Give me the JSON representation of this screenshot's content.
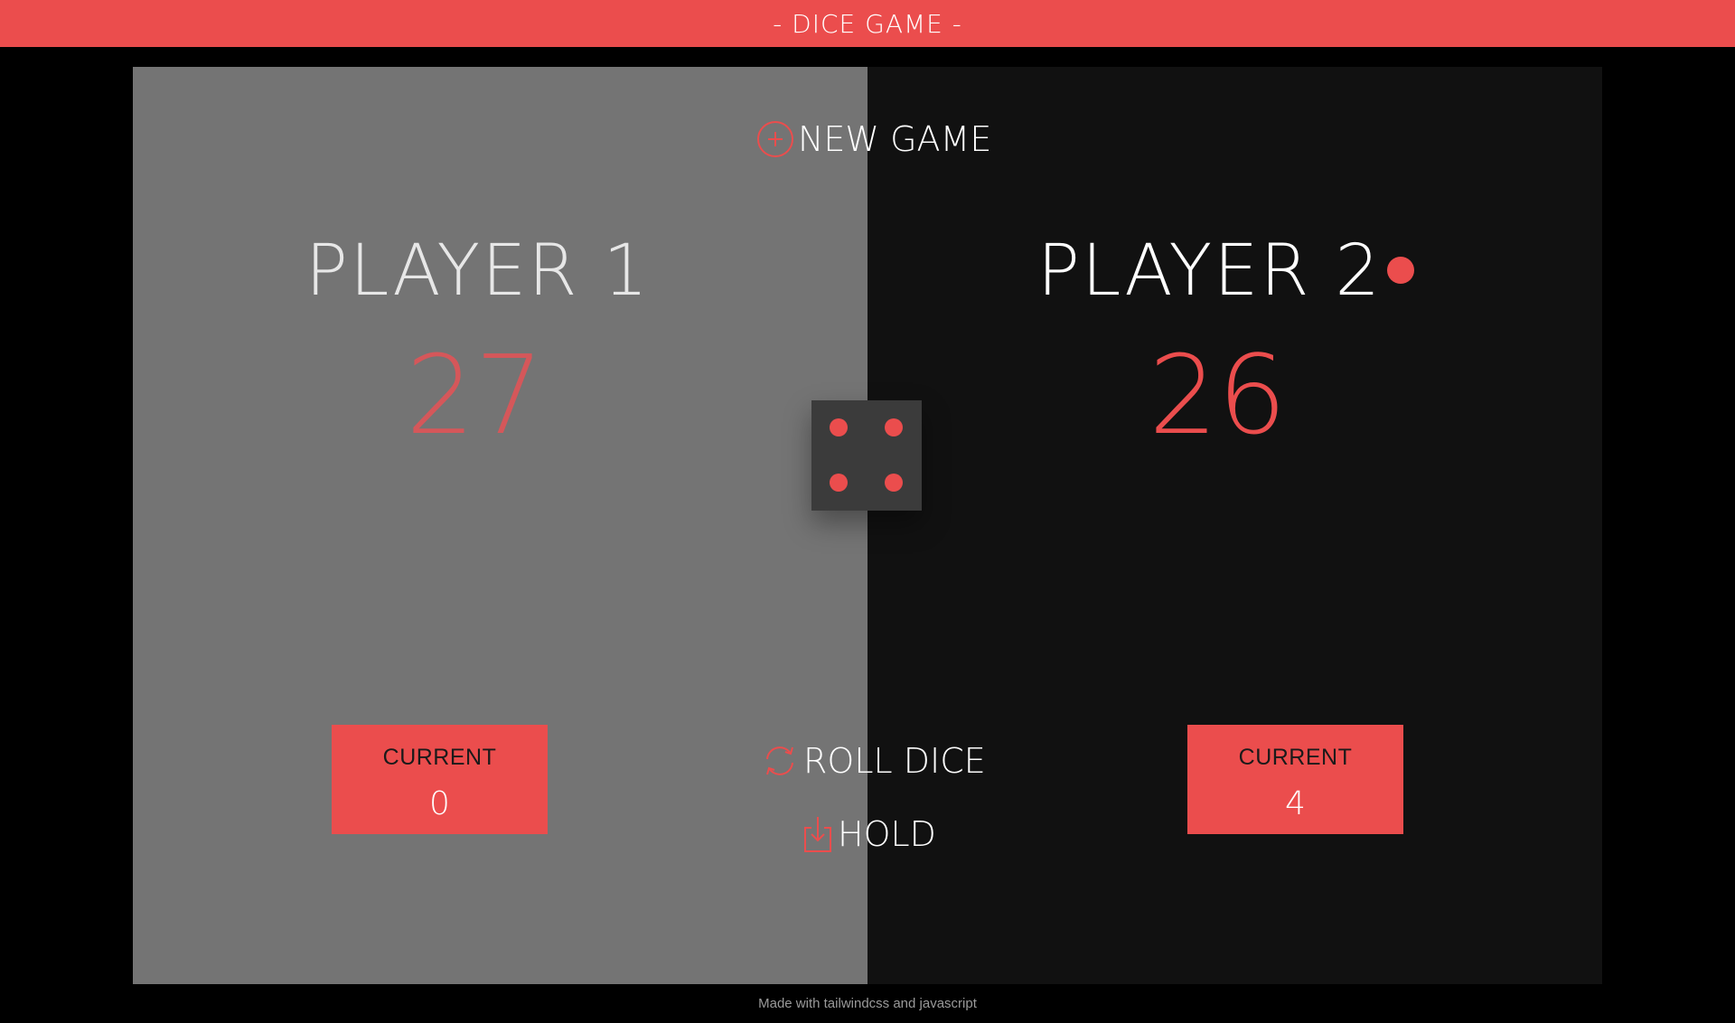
{
  "header": {
    "title": "- DICE GAME -"
  },
  "colors": {
    "accent": "#eb4d4d",
    "panel_inactive": "#747474",
    "panel_active": "#111111",
    "dice_face": "#3b3b3b"
  },
  "players": [
    {
      "name": "PLAYER 1",
      "score": "27",
      "current_label": "CURRENT",
      "current_value": "0",
      "active": false
    },
    {
      "name": "PLAYER 2",
      "score": "26",
      "current_label": "CURRENT",
      "current_value": "4",
      "active": true
    }
  ],
  "controls": {
    "new_game_label": "NEW GAME",
    "new_game_icon": "plus-circle-icon",
    "roll_dice_label": "ROLL DICE",
    "roll_dice_icon": "refresh-icon",
    "hold_label": "HOLD",
    "hold_icon": "download-icon"
  },
  "dice": {
    "value": 4
  },
  "footer": {
    "text": "Made with tailwindcss and javascript"
  }
}
